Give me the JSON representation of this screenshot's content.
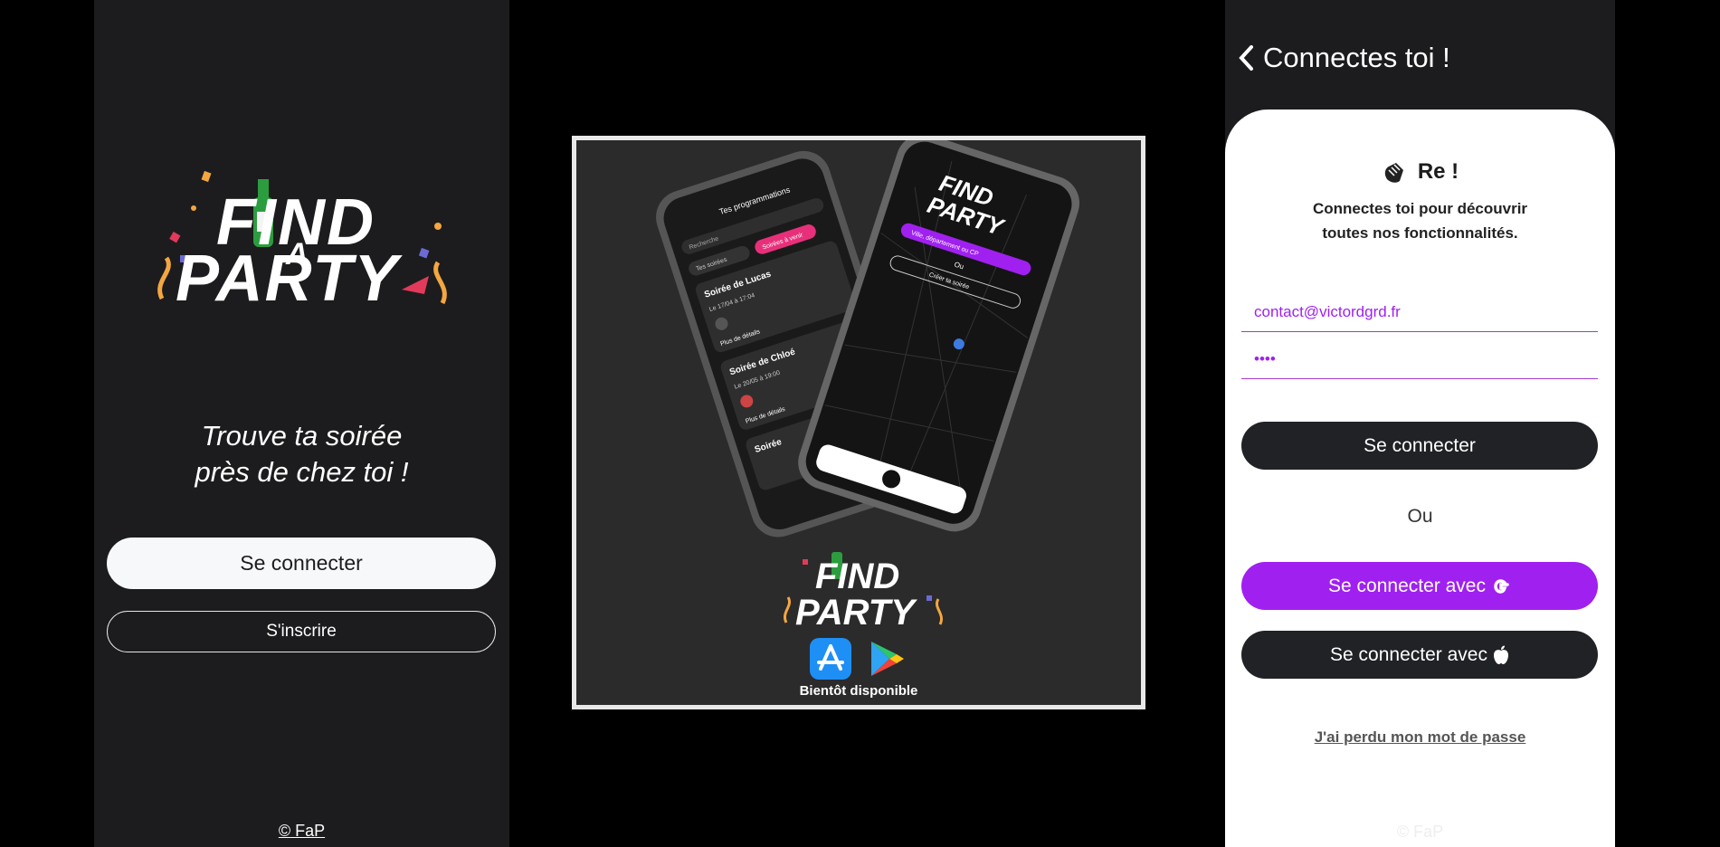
{
  "left": {
    "tagline_line1": "Trouve ta soirée",
    "tagline_line2": "près de chez toi !",
    "login_label": "Se connecter",
    "register_label": "S'inscrire",
    "footer": "© FaP"
  },
  "logo": {
    "line1": "FIND",
    "line2": "A",
    "line3": "PARTY"
  },
  "promo": {
    "soon_label": "Bientôt disponible",
    "phone_left": {
      "title": "Tes programmations",
      "search_placeholder": "Recherche",
      "tab_all": "Tes soirées",
      "tab_upcoming": "Soirées à venir",
      "event1_name": "Soirée de Lucas",
      "event1_date": "Le 17/04 à 17:04",
      "event1_more": "Plus de détails",
      "event2_name": "Soirée de Chloé",
      "event2_date": "Le 20/05 à 19:00",
      "event2_more": "Plus de détails",
      "event3_name": "Soirée"
    },
    "phone_right": {
      "search_label": "Ville, département ou CP",
      "or_label": "Ou",
      "create_label": "Créer ta soirée"
    }
  },
  "right": {
    "header_title": "Connectes toi !",
    "hello": "Re !",
    "subtitle_line1": "Connectes toi pour découvrir",
    "subtitle_line2": "toutes nos fonctionnalités.",
    "email_value": "contact@victordgrd.fr",
    "password_value": "••••",
    "login_label": "Se connecter",
    "or_label": "Ou",
    "google_label": "Se connecter avec",
    "apple_label": "Se connecter avec",
    "forgot_label": "J'ai perdu mon mot de passe",
    "footer": "© FaP"
  },
  "colors": {
    "accent_purple": "#a020f0",
    "dark_bg": "#1c1c1e",
    "button_dark": "#202226",
    "logo_orange": "#f4a640"
  }
}
